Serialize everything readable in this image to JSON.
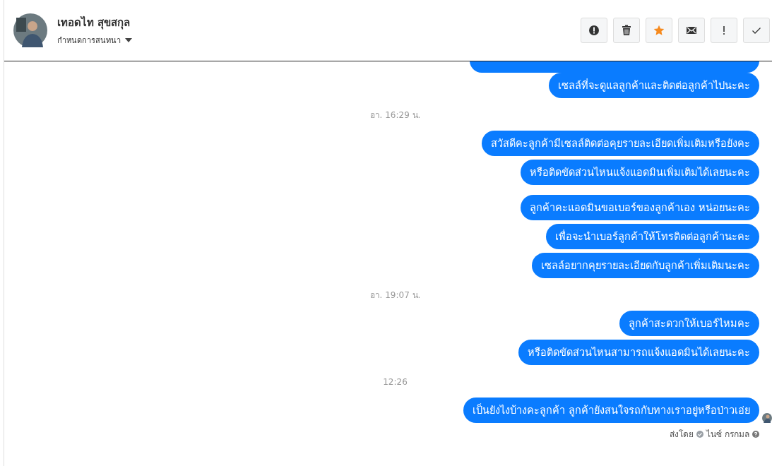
{
  "header": {
    "name": "เทอดไท สุขสกุล",
    "subtitle": "กำหนดการสนทนา",
    "actions": [
      {
        "kind": "alert",
        "on": false
      },
      {
        "kind": "trash",
        "on": false
      },
      {
        "kind": "star",
        "on": true
      },
      {
        "kind": "mail",
        "on": false
      },
      {
        "kind": "important",
        "on": false
      },
      {
        "kind": "check",
        "on": false
      }
    ]
  },
  "sections": [
    {
      "cut_bubble": true,
      "groups": [
        [
          "เซลล์ที่จะดูแลลูกค้าและติดต่อลูกค้าไปนะคะ"
        ]
      ]
    },
    {
      "time": "อา. 16:29 น.",
      "groups": [
        [
          "สวัสดีคะลูกค้ามีเซลล์ติดต่อคุยรายละเอียดเพิ่มเติมหรือยังคะ",
          "หรือติดขัดส่วนไหนแจ้งแอดมินเพิ่มเติมได้เลยนะคะ"
        ],
        [
          "ลูกค้าคะแอดมินขอเบอร์ของลูกค้าเอง หน่อยนะคะ",
          "เพื่อจะนำเบอร์ลูกค้าให้โทรติดต่อลูกค้านะคะ",
          "เซลล์อยากคุยรายละเอียดกับลูกค้าเพิ่มเติมนะคะ"
        ]
      ]
    },
    {
      "time": "อา. 19:07 น.",
      "groups": [
        [
          "ลูกค้าสะดวกให้เบอร์ไหมคะ",
          "หรือติดขัดส่วนไหนสามารถแจ้งแอดมินได้เลยนะคะ"
        ]
      ]
    },
    {
      "time": "12:26",
      "groups": [
        [
          "เป็นยังไงบ้างคะลูกค้า ลูกค้ายังสนใจรถกับทางเราอยู่หรือป่าวเอ่ย"
        ]
      ]
    }
  ],
  "sent_by": {
    "label": "ส่งโดย",
    "name": "ไนซ์ กรกมล"
  }
}
